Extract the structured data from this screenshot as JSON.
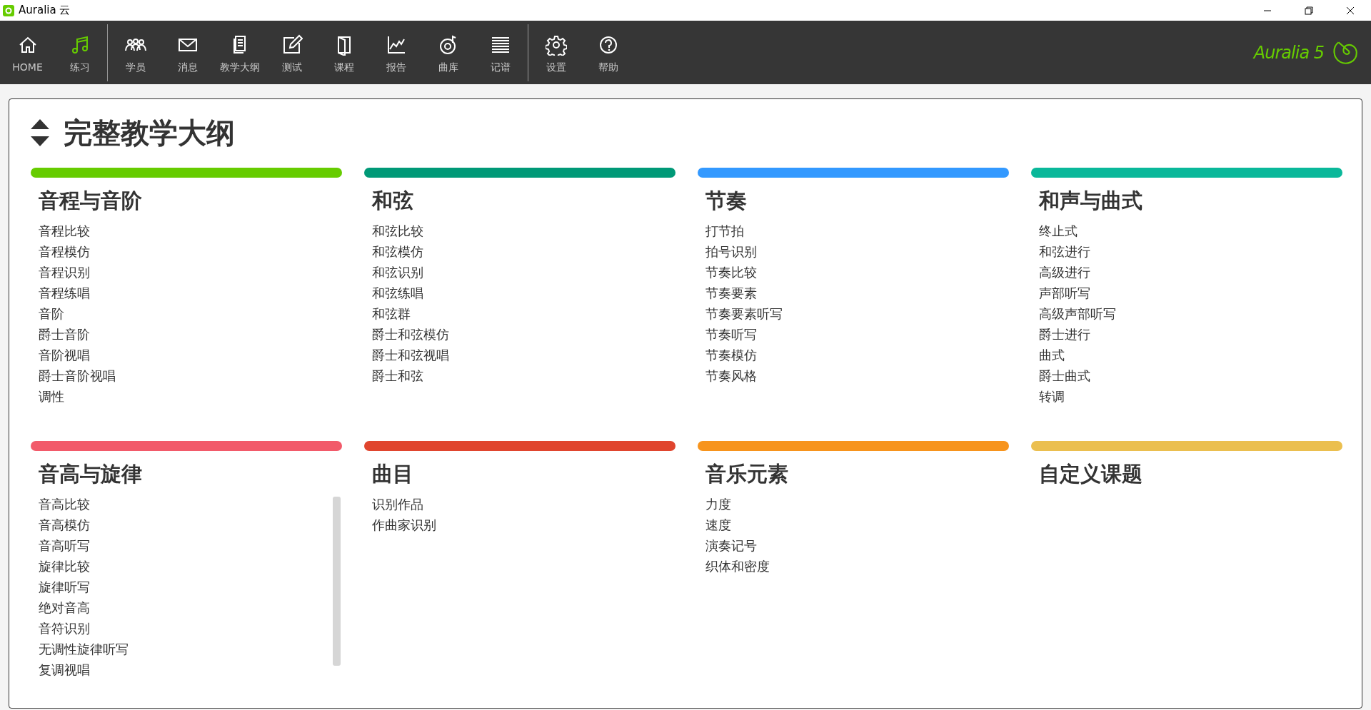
{
  "window": {
    "title": "Auralia 云"
  },
  "toolbar": {
    "groups": [
      [
        {
          "label": "HOME",
          "selected": false
        },
        {
          "label": "练习",
          "selected": true
        }
      ],
      [
        {
          "label": "学员",
          "selected": false
        },
        {
          "label": "消息",
          "selected": false
        },
        {
          "label": "教学大纲",
          "selected": false
        },
        {
          "label": "测试",
          "selected": false
        },
        {
          "label": "课程",
          "selected": false
        },
        {
          "label": "报告",
          "selected": false
        },
        {
          "label": "曲库",
          "selected": false
        },
        {
          "label": "记谱",
          "selected": false
        }
      ],
      [
        {
          "label": "设置",
          "selected": false
        },
        {
          "label": "帮助",
          "selected": false
        }
      ]
    ]
  },
  "logo": {
    "text": "Auralia 5"
  },
  "syllabus": {
    "title": "完整教学大纲",
    "sections": [
      {
        "title": "音程与音阶",
        "color": "#66cc00",
        "items": [
          "音程比较",
          "音程模仿",
          "音程识别",
          "音程练唱",
          "音阶",
          "爵士音阶",
          "音阶视唱",
          "爵士音阶视唱",
          "调性"
        ]
      },
      {
        "title": "和弦",
        "color": "#009977",
        "items": [
          "和弦比较",
          "和弦模仿",
          "和弦识别",
          "和弦练唱",
          "和弦群",
          "爵士和弦模仿",
          "爵士和弦视唱",
          "爵士和弦"
        ]
      },
      {
        "title": "节奏",
        "color": "#3399ff",
        "items": [
          "打节拍",
          "拍号识别",
          "节奏比较",
          "节奏要素",
          "节奏要素听写",
          "节奏听写",
          "节奏模仿",
          "节奏风格"
        ]
      },
      {
        "title": "和声与曲式",
        "color": "#0ab89a",
        "items": [
          "终止式",
          "和弦进行",
          "高级进行",
          "声部听写",
          "高级声部听写",
          "爵士进行",
          "曲式",
          "爵士曲式",
          "转调"
        ]
      },
      {
        "title": "音高与旋律",
        "color": "#f25a6a",
        "items": [
          "音高比较",
          "音高模仿",
          "音高听写",
          "旋律比较",
          "旋律听写",
          "绝对音高",
          "音符识别",
          "无调性旋律听写",
          "复调视唱"
        ]
      },
      {
        "title": "曲目",
        "color": "#e0452e",
        "items": [
          "识别作品",
          "作曲家识别"
        ]
      },
      {
        "title": "音乐元素",
        "color": "#f7941d",
        "items": [
          "力度",
          "速度",
          "演奏记号",
          "织体和密度"
        ]
      },
      {
        "title": "自定义课题",
        "color": "#ebbf4f"
      }
    ]
  }
}
